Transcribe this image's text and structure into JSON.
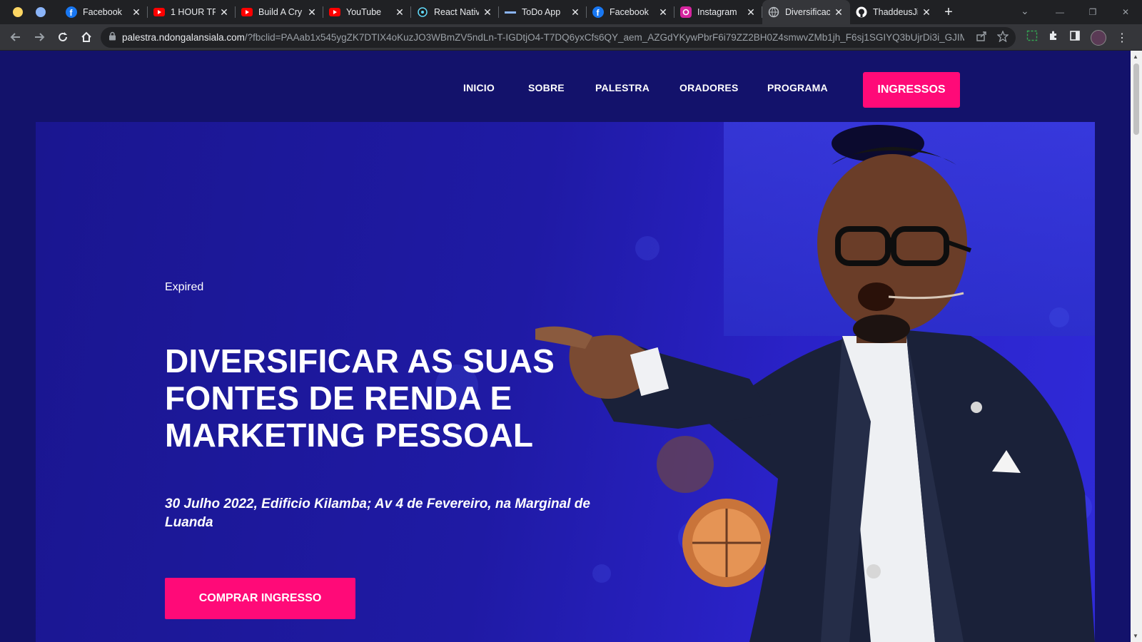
{
  "browser": {
    "tabs": [
      {
        "title": "Facebook",
        "icon": "facebook-icon",
        "active": false
      },
      {
        "title": "1 HOUR TR",
        "icon": "youtube-icon",
        "active": false
      },
      {
        "title": "Build A Cry",
        "icon": "youtube-icon",
        "active": false
      },
      {
        "title": "YouTube",
        "icon": "youtube-icon",
        "active": false
      },
      {
        "title": "React Nativ",
        "icon": "react-icon",
        "active": false
      },
      {
        "title": "ToDo App",
        "icon": "todo-icon",
        "active": false
      },
      {
        "title": "Facebook",
        "icon": "facebook-icon",
        "active": false
      },
      {
        "title": "Instagram",
        "icon": "instagram-icon",
        "active": false
      },
      {
        "title": "Diversificac",
        "icon": "globe-icon",
        "active": true
      },
      {
        "title": "ThaddeusJi",
        "icon": "github-icon",
        "active": false
      }
    ],
    "url_host": "palestra.ndongalansiala.com",
    "url_rest": "/?fbclid=PAAab1x545ygZK7DTIX4oKuzJO3WBmZV5ndLn-T-IGDtjO4-T7DQ6yxCfs6QY_aem_AZGdYKywPbrF6i79ZZ2BH0Z4smwvZMb1jh_F6sj1SGIYQ3bUjrDi3i_GJIM..."
  },
  "nav": {
    "items": [
      "INICIO",
      "SOBRE",
      "PALESTRA",
      "ORADORES",
      "PROGRAMA"
    ],
    "cta": "INGRESSOS"
  },
  "hero": {
    "status": "Expired",
    "headline": "DIVERSIFICAR AS SUAS FONTES DE RENDA E MARKETING PESSOAL",
    "details": "30 Julho 2022, Edificio Kilamba; Av 4 de Fevereiro, na Marginal de Luanda",
    "button": "COMPRAR INGRESSO"
  },
  "colors": {
    "page_bg": "#13126b",
    "accent": "#ff0a78",
    "hero_bg": "#1f1aa4"
  }
}
